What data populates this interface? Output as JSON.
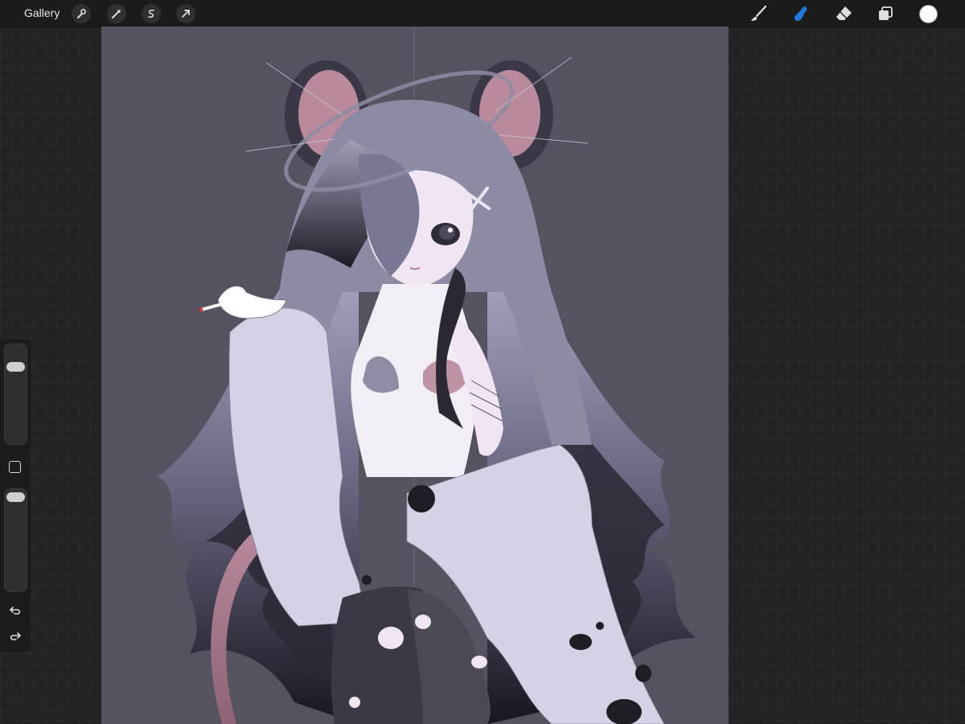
{
  "toolbar": {
    "gallery_label": "Gallery",
    "left_tools": [
      "wrench-icon",
      "magic-wand-icon",
      "selection-icon",
      "transform-arrow-icon"
    ],
    "right_tools": [
      "brush-icon",
      "smudge-icon",
      "eraser-icon",
      "layers-icon"
    ],
    "active_tool": "smudge-icon",
    "active_color": "#ffffff",
    "accent_color": "#1f7ae0"
  },
  "sidebar": {
    "brush_size_slider": "size-slider",
    "opacity_slider": "opacity-slider",
    "modify_button": "modify-square-icon",
    "undo": "undo-icon",
    "redo": "redo-icon"
  },
  "canvas": {
    "background_color": "#55535f"
  }
}
